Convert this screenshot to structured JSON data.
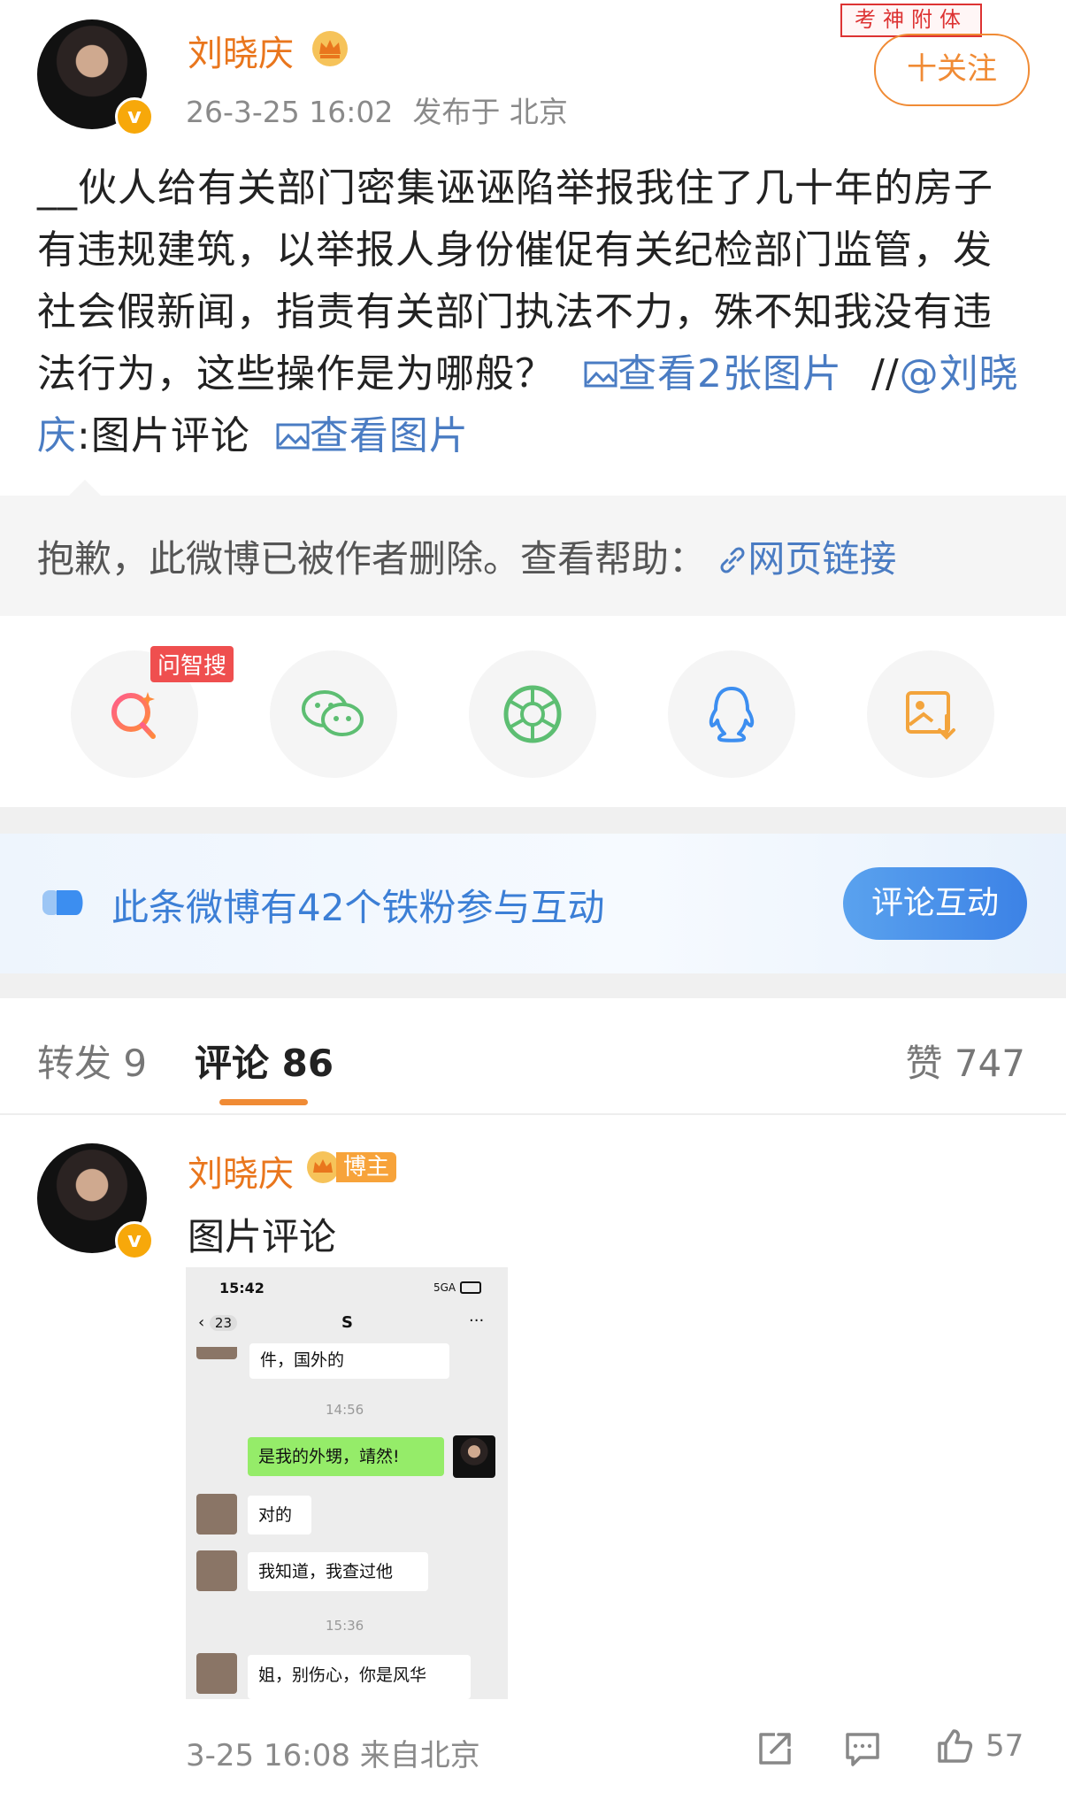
{
  "header": {
    "author_name": "刘晓庆",
    "crown_icon": "crown-icon",
    "timestamp": "26-3-25 16:02",
    "location": "发布于 北京",
    "stamp_text": "考神附体",
    "follow_label": "十关注"
  },
  "post": {
    "text": "__伙人给有关部门密集诬诬陷举报我住了几十年的房子有违规建筑，以举报人身份催促有关纪检部门监管，发社会假新闻，指责有关部门执法不力，殊不知我没有违法行为，这些操作是为哪般？",
    "view_images_link": "查看2张图片",
    "repost_prefix": "//",
    "mention": "@刘晓庆",
    "repost_suffix": ":图片评论",
    "view_image_link": "查看图片"
  },
  "deleted_notice": {
    "text": "抱歉，此微博已被作者删除。查看帮助：",
    "link": "网页链接"
  },
  "share": {
    "items": [
      {
        "name": "wenzhisou-icon",
        "badge": "问智搜",
        "color": "#ef4f4f"
      },
      {
        "name": "wechat-icon",
        "color": "#5dbe72"
      },
      {
        "name": "moments-icon",
        "color": "#5dbe72"
      },
      {
        "name": "qq-icon",
        "color": "#3c8ef0"
      },
      {
        "name": "save-image-icon",
        "color": "#f3a43c"
      }
    ]
  },
  "fans_banner": {
    "text": "此条微博有42个铁粉参与互动",
    "button": "评论互动"
  },
  "tabs": {
    "repost": "转发 9",
    "comments": "评论 86",
    "likes": "赞 747"
  },
  "comment": {
    "author": "刘晓庆",
    "badge": "博主",
    "text": "图片评论",
    "time": "3-25 16:08 来自北京",
    "like_count": "57",
    "screenshot": {
      "status_time": "15:42",
      "status_net": "5GA",
      "back_count": "23",
      "chat_title": "S",
      "more": "···",
      "msg0": "件，国外的",
      "time1": "14:56",
      "msg1": "是我的外甥，靖然!",
      "msg2": "对的",
      "msg3": "我知道，我查过他",
      "time2": "15:36",
      "msg4": "姐，别伤心，你是风华"
    }
  }
}
